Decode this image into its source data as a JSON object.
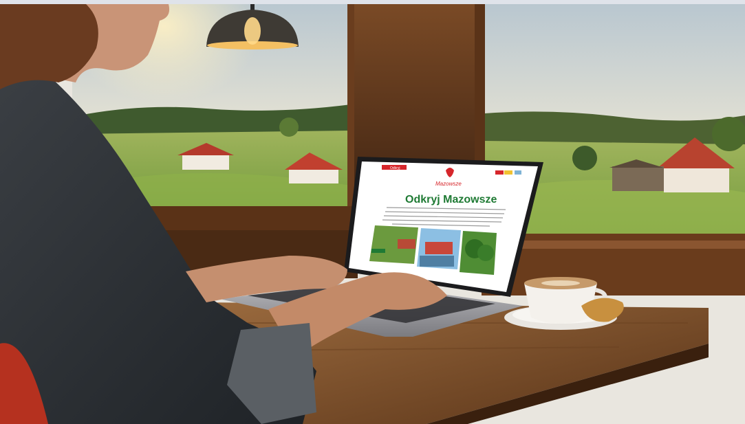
{
  "scene": {
    "brand": "Mazowsze",
    "headline": "Odkryj Mazowsze",
    "tag_small": "Odkryj"
  },
  "colors": {
    "brand_red": "#d6262b",
    "brand_green": "#1f7a34",
    "wood_dark": "#4a2a14",
    "wood_light": "#8a5a33"
  }
}
